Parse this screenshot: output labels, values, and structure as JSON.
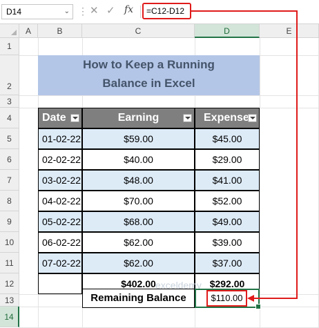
{
  "formula_bar": {
    "name_box": "D14",
    "formula": "=C12-D12",
    "fx_label": "fx"
  },
  "columns": [
    "A",
    "B",
    "C",
    "D",
    "E"
  ],
  "rows": [
    "1",
    "2",
    "3",
    "4",
    "5",
    "6",
    "7",
    "8",
    "9",
    "10",
    "11",
    "12",
    "13",
    "14"
  ],
  "title": {
    "line1": "How to Keep a Running",
    "line2": "Balance in Excel"
  },
  "table": {
    "headers": [
      "Date",
      "Earning",
      "Expense"
    ],
    "rows": [
      {
        "date": "01-02-22",
        "earning": "$59.00",
        "expense": "$45.00"
      },
      {
        "date": "02-02-22",
        "earning": "$40.00",
        "expense": "$29.00"
      },
      {
        "date": "03-02-22",
        "earning": "$48.00",
        "expense": "$41.00"
      },
      {
        "date": "04-02-22",
        "earning": "$70.00",
        "expense": "$52.00"
      },
      {
        "date": "05-02-22",
        "earning": "$68.00",
        "expense": "$49.00"
      },
      {
        "date": "06-02-22",
        "earning": "$62.00",
        "expense": "$39.00"
      },
      {
        "date": "07-02-22",
        "earning": "$62.00",
        "expense": "$37.00"
      }
    ],
    "total_earning": "$402.00",
    "total_expense": "$292.00"
  },
  "remaining": {
    "label": "Remaining Balance",
    "value": "$110.00"
  },
  "watermark": "exceldemy",
  "colors": {
    "highlight_red": "#e01a1a",
    "excel_green": "#217346",
    "title_bg": "#b4c6e7",
    "header_bg": "#7f7f7f",
    "row_alt": "#ddebf7"
  }
}
